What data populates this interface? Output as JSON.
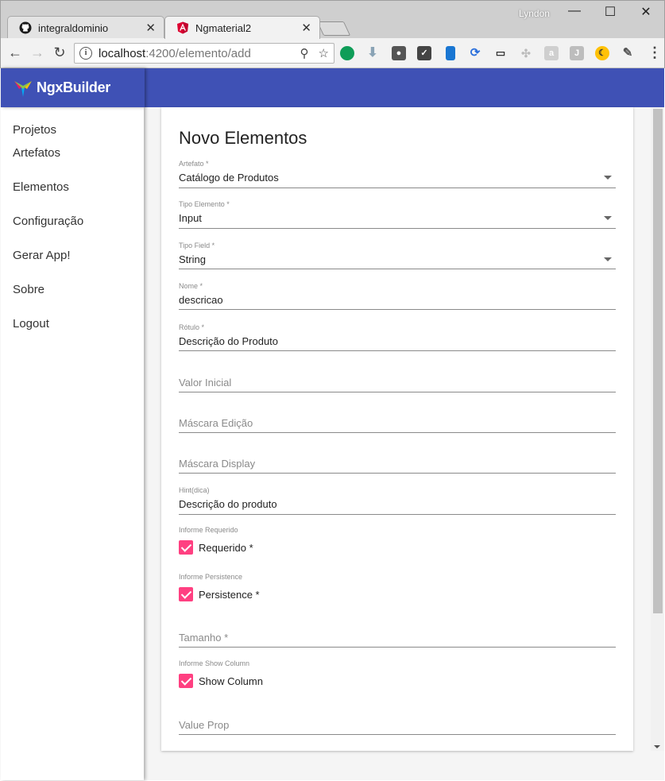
{
  "browser": {
    "tabs": [
      {
        "title": "integraldominio",
        "icon": "github-icon"
      },
      {
        "title": "Ngmaterial2",
        "icon": "angular-icon"
      }
    ],
    "close_glyph": "✕",
    "profile_name": "Lyndon",
    "window_controls": {
      "minimize": "—",
      "maximize": "☐",
      "close": "✕"
    },
    "nav": {
      "back": "←",
      "forward": "→",
      "reload": "↻"
    },
    "url_host": "localhost",
    "url_path": ":4200/elemento/add",
    "info_glyph": "i",
    "zoom_glyph": "⚲",
    "star_glyph": "☆",
    "menu_glyph": "⋮",
    "extensions": [
      "green-dot-extension-icon",
      "download-extension-icon",
      "lightbulb-extension-icon",
      "pocket-extension-icon",
      "colorful-extension-icon",
      "sync-extension-icon",
      "bus-extension-icon",
      "puzzle-extension-icon",
      "lock-extension-icon",
      "j-extension-icon",
      "moon-extension-icon",
      "evernote-extension-icon"
    ]
  },
  "app": {
    "brand": "NgxBuilder",
    "primary_color": "#3f51b5",
    "accent_color": "#ff4081"
  },
  "sidenav": {
    "items": [
      "Projetos",
      "Artefatos",
      "Elementos",
      "Configuração",
      "Gerar App!",
      "Sobre",
      "Logout"
    ]
  },
  "form": {
    "title": "Novo Elementos",
    "artefato": {
      "label": "Artefato *",
      "value": "Catálogo de Produtos"
    },
    "tipo_elemento": {
      "label": "Tipo Elemento *",
      "value": "Input"
    },
    "tipo_field": {
      "label": "Tipo Field *",
      "value": "String"
    },
    "nome": {
      "label": "Nome *",
      "value": "descricao"
    },
    "rotulo": {
      "label": "Rótulo *",
      "value": "Descrição do Produto"
    },
    "valor_inicial": {
      "placeholder": "Valor Inicial"
    },
    "mascara_edicao": {
      "placeholder": "Máscara Edição"
    },
    "mascara_display": {
      "placeholder": "Máscara Display"
    },
    "hint": {
      "label": "Hint(dica)",
      "value": "Descrição do produto"
    },
    "requerido": {
      "group_label": "Informe Requerido",
      "label": "Requerido *",
      "checked": true
    },
    "persistence": {
      "group_label": "Informe Persistence",
      "label": "Persistence *",
      "checked": true
    },
    "tamanho": {
      "placeholder": "Tamanho *"
    },
    "show_column": {
      "group_label": "Informe Show Column",
      "label": "Show Column",
      "checked": true
    },
    "value_prop": {
      "placeholder": "Value Prop"
    }
  }
}
